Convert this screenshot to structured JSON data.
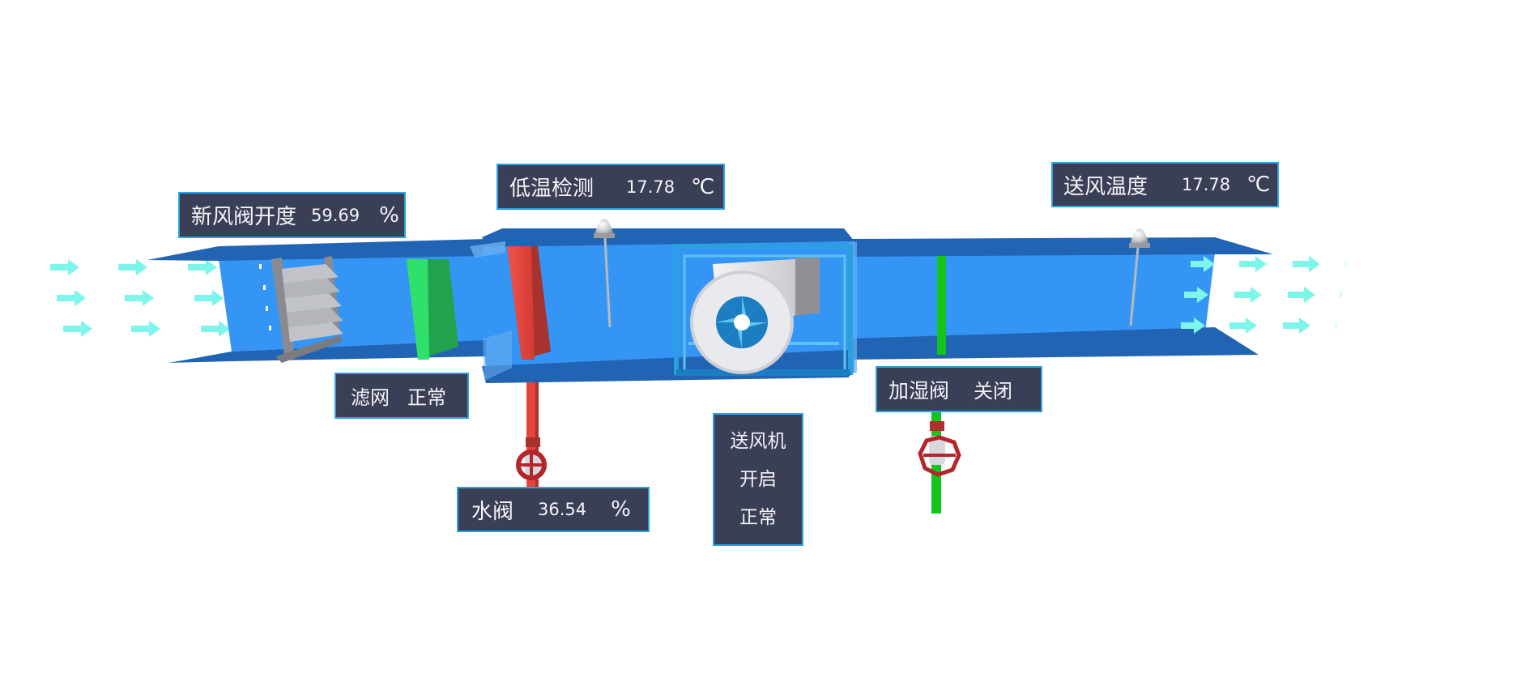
{
  "colors": {
    "duct_face": "#3595f5",
    "duct_plate": "#2264b4",
    "panel_bg": "#3a3f55",
    "panel_border": "#2aa3e6",
    "panel_text": "#f2f4f8",
    "airflow_arrow": "#7df5ea",
    "filter_green": "#2fe06a",
    "coil_red": "#e8443d",
    "humid_pipe_green": "#13c41c",
    "valve_red": "#b3262a",
    "fan_blade": "#3aa8e0"
  },
  "panels": {
    "fresh_damper": {
      "label": "新风阀开度",
      "value": "59.69",
      "unit": "%"
    },
    "low_temp": {
      "label": "低温检测",
      "value": "17.78",
      "unit": "℃"
    },
    "supply_temp": {
      "label": "送风温度",
      "value": "17.78",
      "unit": "℃"
    },
    "filter": {
      "label": "滤网",
      "status": "正常"
    },
    "water_valve": {
      "label": "水阀",
      "value": "36.54",
      "unit": "%"
    },
    "supply_fan": {
      "label": "送风机",
      "run_state": "开启",
      "fault_state": "正常"
    },
    "humidifier_valve": {
      "label": "加湿阀",
      "status": "关闭"
    }
  },
  "components": {
    "fresh_air_damper": {
      "icon": "louver-damper-icon",
      "open_fraction": 0.5969
    },
    "filter": {
      "icon": "filter-panel-icon"
    },
    "cooling_coil": {
      "icon": "coil-icon"
    },
    "water_valve": {
      "icon": "gate-valve-icon",
      "open_fraction": 0.3654
    },
    "supply_fan": {
      "icon": "centrifugal-fan-icon"
    },
    "humidifier": {
      "icon": "gate-valve-icon"
    },
    "temp_sensors": {
      "icon": "temperature-probe-icon"
    },
    "airflow": {
      "icon": "airflow-arrow-icon",
      "direction": "left-to-right"
    }
  }
}
